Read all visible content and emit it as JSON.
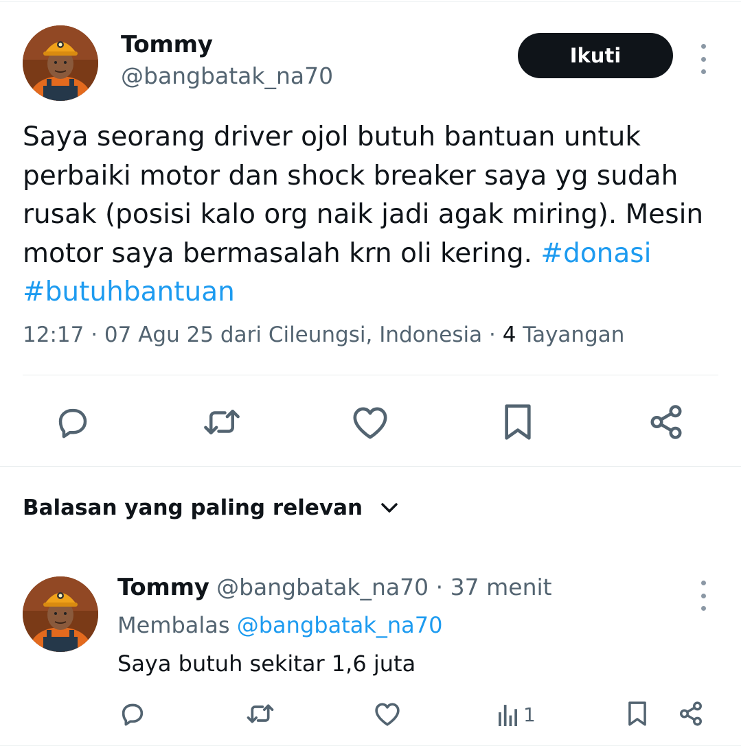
{
  "tweet": {
    "author": {
      "name": "Tommy",
      "handle": "@bangbatak_na70",
      "avatar_icon": "miner-avatar"
    },
    "follow_label": "Ikuti",
    "more_icon": "more-vertical-icon",
    "text_plain": "Saya seorang driver ojol butuh bantuan untuk perbaiki motor dan shock breaker saya yg sudah rusak (posisi kalo org naik jadi agak miring). Mesin motor saya bermasalah krn oli kering. ",
    "hashtags": [
      "#donasi",
      "#butuhbantuan"
    ],
    "meta": {
      "time": "12:17",
      "date": "07 Agu 25",
      "location_prefix": "dari",
      "location": "Cileungsi, Indonesia",
      "views_count": "4",
      "views_label": "Tayangan"
    },
    "actions": [
      {
        "name": "reply",
        "icon": "reply-icon"
      },
      {
        "name": "retweet",
        "icon": "retweet-icon"
      },
      {
        "name": "like",
        "icon": "heart-icon"
      },
      {
        "name": "bookmark",
        "icon": "bookmark-icon"
      },
      {
        "name": "share",
        "icon": "share-icon"
      }
    ]
  },
  "replies_sort": {
    "label": "Balasan yang paling relevan",
    "icon": "chevron-down-icon"
  },
  "reply": {
    "author": {
      "name": "Tommy",
      "handle": "@bangbatak_na70",
      "avatar_icon": "miner-avatar"
    },
    "separator": "·",
    "time_ago": "37 menit",
    "replying_prefix": "Membalas",
    "replying_to": "@bangbatak_na70",
    "text": "Saya butuh sekitar 1,6 juta",
    "views": "1",
    "accent_color": "#1d9bf0"
  }
}
